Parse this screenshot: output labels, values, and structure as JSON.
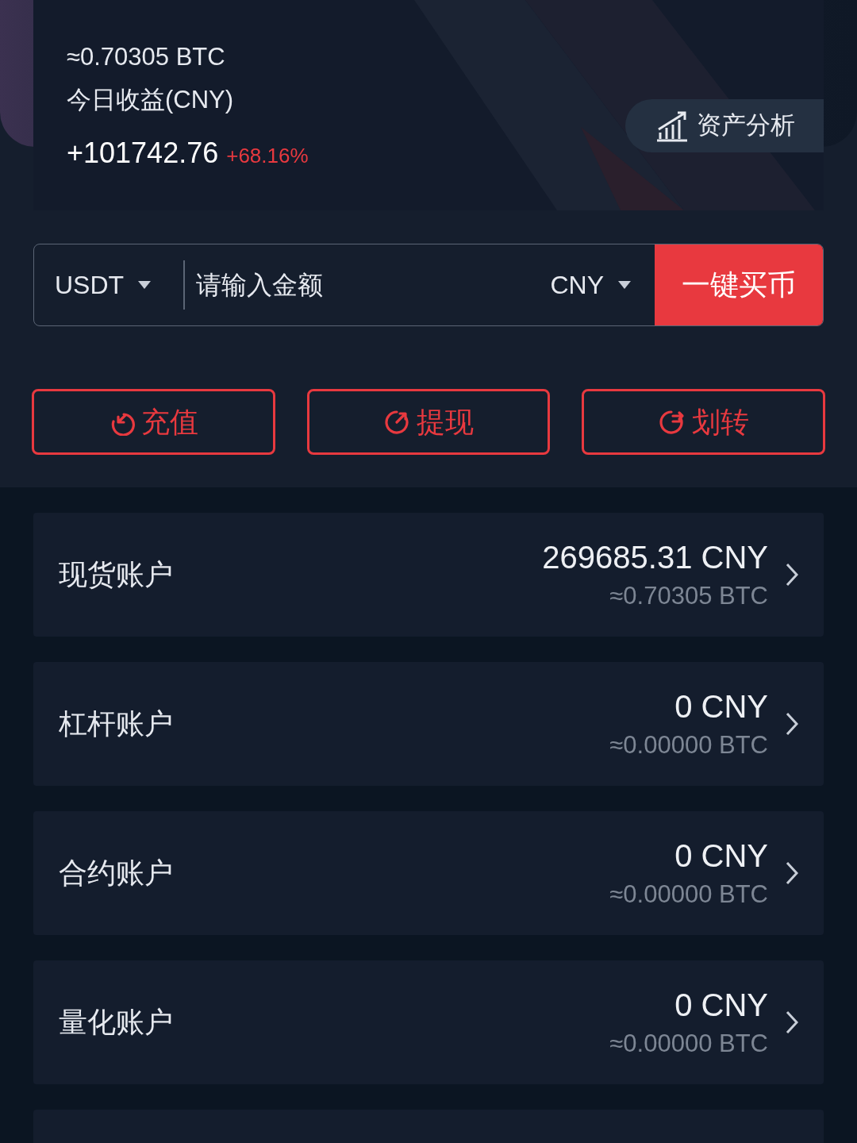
{
  "summary": {
    "btc_equivalent": "≈0.70305 BTC",
    "today_label": "今日收益(CNY)",
    "today_profit": "+101742.76",
    "today_percent": "+68.16%",
    "analysis_button": "资产分析"
  },
  "buy_bar": {
    "coin": "USDT",
    "placeholder": "请输入金额",
    "currency": "CNY",
    "button": "一键买币"
  },
  "actions": [
    {
      "kind": "deposit",
      "label": "充值"
    },
    {
      "kind": "withdraw",
      "label": "提现"
    },
    {
      "kind": "transfer",
      "label": "划转"
    }
  ],
  "accounts": [
    {
      "kind": "account",
      "name": "现货账户",
      "amount": "269685.31 CNY",
      "btc": "≈0.70305 BTC"
    },
    {
      "kind": "account",
      "name": "杠杆账户",
      "amount": "0 CNY",
      "btc": "≈0.00000 BTC"
    },
    {
      "kind": "account",
      "name": "合约账户",
      "amount": "0 CNY",
      "btc": "≈0.00000 BTC"
    },
    {
      "kind": "account",
      "name": "量化账户",
      "amount": "0 CNY",
      "btc": "≈0.00000 BTC"
    },
    {
      "kind": "partial"
    }
  ]
}
